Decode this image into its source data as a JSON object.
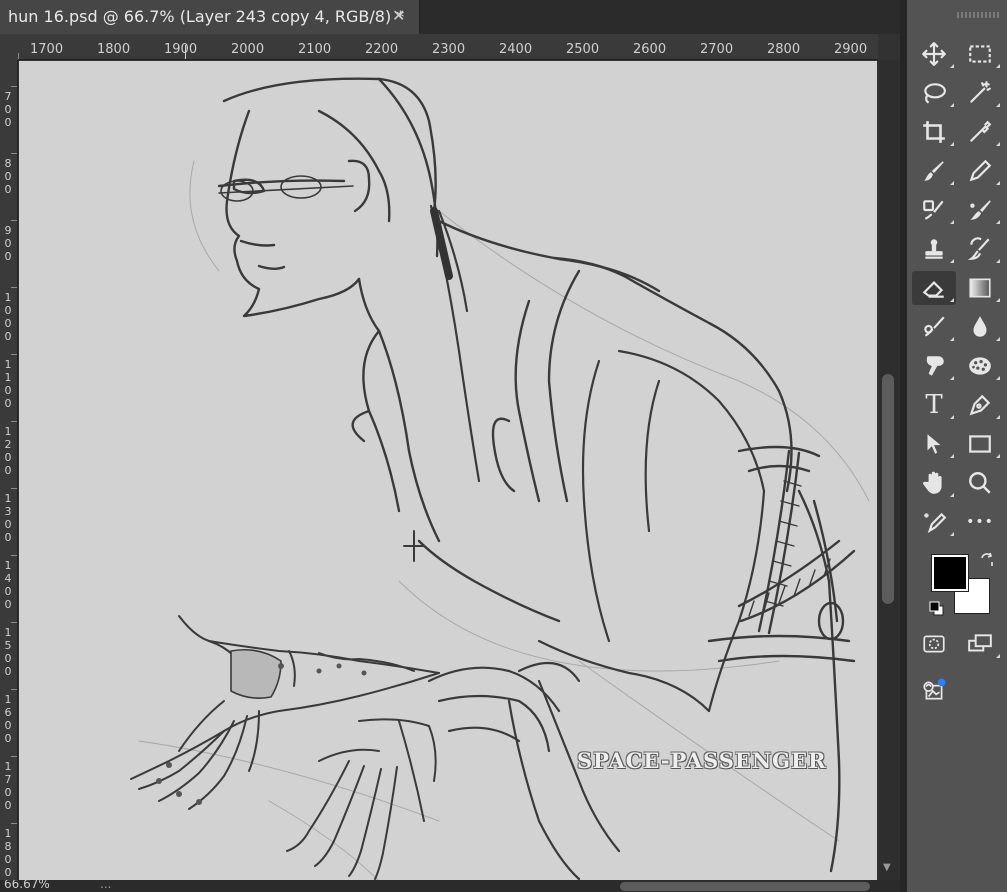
{
  "document": {
    "tab_title": "hun 16.psd @ 66.7% (Layer 243 copy 4, RGB/8) *",
    "close_glyph": "✕"
  },
  "ruler": {
    "horizontal_labels": [
      "1700",
      "1800",
      "1900",
      "2000",
      "2100",
      "2200",
      "2300",
      "2400",
      "2500",
      "2600",
      "2700",
      "2800",
      "2900"
    ],
    "vertical_labels": [
      [
        "7",
        "0",
        "0"
      ],
      [
        "8",
        "0",
        "0"
      ],
      [
        "9",
        "0",
        "0"
      ],
      [
        "1",
        "0",
        "0",
        "0"
      ],
      [
        "1",
        "1",
        "0",
        "0"
      ],
      [
        "1",
        "2",
        "0",
        "0"
      ],
      [
        "1",
        "3",
        "0",
        "0"
      ],
      [
        "1",
        "4",
        "0",
        "0"
      ],
      [
        "1",
        "5",
        "0",
        "0"
      ],
      [
        "1",
        "6",
        "0",
        "0"
      ],
      [
        "1",
        "7",
        "0",
        "0"
      ],
      [
        "1",
        "8",
        "0",
        "0"
      ]
    ]
  },
  "canvas": {
    "background": "#d2d2d2",
    "watermark": "SPACE-PASSENGER"
  },
  "status": {
    "zoom": "66.67%",
    "info": "..."
  },
  "tools": {
    "items": [
      {
        "name": "move-tool",
        "icon": "move-icon"
      },
      {
        "name": "rectangular-marquee-tool",
        "icon": "marquee-icon"
      },
      {
        "name": "lasso-tool",
        "icon": "lasso-icon"
      },
      {
        "name": "magic-wand-tool",
        "icon": "magic-wand-icon"
      },
      {
        "name": "crop-tool",
        "icon": "crop-icon"
      },
      {
        "name": "eyedropper-tool",
        "icon": "eyedropper-icon"
      },
      {
        "name": "brush-tool",
        "icon": "brush-icon"
      },
      {
        "name": "pencil-tool",
        "icon": "pencil-icon"
      },
      {
        "name": "healing-brush-tool",
        "icon": "healing-brush-icon"
      },
      {
        "name": "mixer-brush-tool",
        "icon": "mixer-brush-icon"
      },
      {
        "name": "clone-stamp-tool",
        "icon": "stamp-icon"
      },
      {
        "name": "history-brush-tool",
        "icon": "history-brush-icon"
      },
      {
        "name": "eraser-tool",
        "icon": "eraser-icon"
      },
      {
        "name": "gradient-tool",
        "icon": "gradient-icon"
      },
      {
        "name": "blur-brush-tool",
        "icon": "blur-brush-icon"
      },
      {
        "name": "blur-tool",
        "icon": "drop-icon"
      },
      {
        "name": "smudge-tool",
        "icon": "smudge-icon"
      },
      {
        "name": "sponge-tool",
        "icon": "sponge-icon"
      },
      {
        "name": "type-tool",
        "icon": "type-icon",
        "glyph": "T"
      },
      {
        "name": "pen-tool",
        "icon": "pen-icon"
      },
      {
        "name": "path-selection-tool",
        "icon": "arrow-icon"
      },
      {
        "name": "rectangle-tool",
        "icon": "rectangle-icon"
      },
      {
        "name": "hand-tool",
        "icon": "hand-icon"
      },
      {
        "name": "zoom-tool",
        "icon": "zoom-icon"
      },
      {
        "name": "edit-toolbar",
        "icon": "edit-toolbar-icon"
      },
      {
        "name": "more-tools",
        "icon": "more-icon",
        "glyph": "•••"
      }
    ],
    "foreground_color": "#000000",
    "background_color": "#ffffff"
  }
}
